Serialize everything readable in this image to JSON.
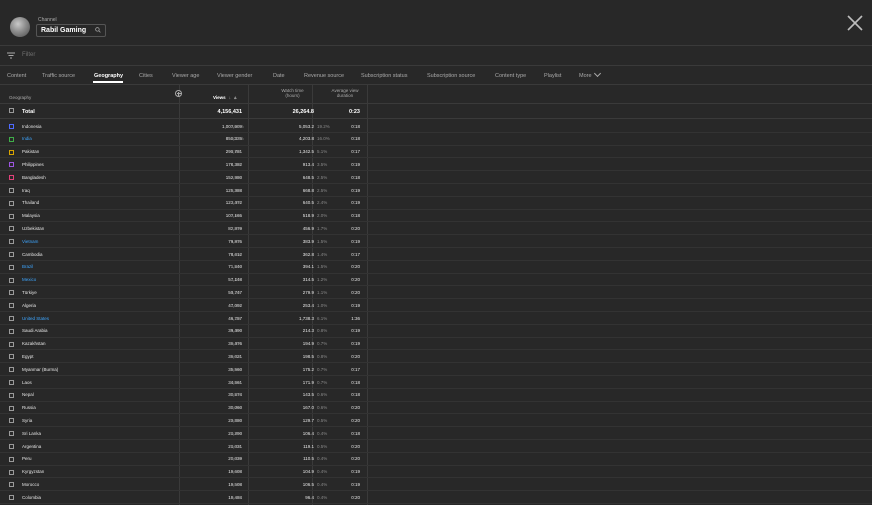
{
  "header": {
    "channel_label": "Channel",
    "channel_name": "Rabil Gaming"
  },
  "filter": {
    "placeholder": "Filter"
  },
  "tabs": [
    "Content",
    "Traffic source",
    "Geography",
    "Cities",
    "Viewer age",
    "Viewer gender",
    "Date",
    "Revenue source",
    "Subscription status",
    "Subscription source",
    "Content type",
    "Playlist",
    "More"
  ],
  "active_tab": "Geography",
  "columns": {
    "geography": "Geography",
    "views": "Views",
    "watch_time": "Watch time (hours)",
    "avg_view_duration": "Average view duration"
  },
  "total": {
    "label": "Total",
    "views": "4,156,431",
    "watch_time": "26,264.8",
    "avg": "0:23"
  },
  "rows": [
    {
      "name": "Indonesia",
      "views": "1,007,909",
      "vpct": "24.3%",
      "wt": "5,053.2",
      "wpct": "19.2%",
      "avg": "0:18",
      "color": "#4f6bff",
      "link": false
    },
    {
      "name": "India",
      "views": "850,335",
      "vpct": "20.5%",
      "wt": "4,203.8",
      "wpct": "16.0%",
      "avg": "0:18",
      "color": "#3fae49",
      "link": true
    },
    {
      "name": "Pakistan",
      "views": "290,781",
      "vpct": "7.0%",
      "wt": "1,342.5",
      "wpct": "5.1%",
      "avg": "0:17",
      "color": "#d9a400",
      "link": false
    },
    {
      "name": "Philippines",
      "views": "176,382",
      "vpct": "4.2%",
      "wt": "913.4",
      "wpct": "3.5%",
      "avg": "0:19",
      "color": "#9d55e0",
      "link": false
    },
    {
      "name": "Bangladesh",
      "views": "152,980",
      "vpct": "3.2%",
      "wt": "648.5",
      "wpct": "2.5%",
      "avg": "0:18",
      "color": "#e0417a",
      "link": false
    },
    {
      "name": "Iraq",
      "views": "125,388",
      "vpct": "3.0%",
      "wt": "668.8",
      "wpct": "2.5%",
      "avg": "0:19",
      "color": "",
      "link": false
    },
    {
      "name": "Thailand",
      "views": "123,472",
      "vpct": "3.0%",
      "wt": "640.5",
      "wpct": "2.4%",
      "avg": "0:19",
      "color": "",
      "link": false
    },
    {
      "name": "Malaysia",
      "views": "107,165",
      "vpct": "2.6%",
      "wt": "518.9",
      "wpct": "2.0%",
      "avg": "0:18",
      "color": "",
      "link": false
    },
    {
      "name": "Uzbekistan",
      "views": "82,879",
      "vpct": "2.0%",
      "wt": "456.9",
      "wpct": "1.7%",
      "avg": "0:20",
      "color": "",
      "link": false
    },
    {
      "name": "Vietnam",
      "views": "79,875",
      "vpct": "1.9%",
      "wt": "383.9",
      "wpct": "1.5%",
      "avg": "0:19",
      "color": "",
      "link": true
    },
    {
      "name": "Cambodia",
      "views": "78,612",
      "vpct": "1.8%",
      "wt": "362.8",
      "wpct": "1.4%",
      "avg": "0:17",
      "color": "",
      "link": false
    },
    {
      "name": "Brazil",
      "views": "71,540",
      "vpct": "1.7%",
      "wt": "394.1",
      "wpct": "1.5%",
      "avg": "0:20",
      "color": "",
      "link": true
    },
    {
      "name": "Mexico",
      "views": "57,148",
      "vpct": "1.4%",
      "wt": "314.5",
      "wpct": "1.2%",
      "avg": "0:20",
      "color": "",
      "link": true
    },
    {
      "name": "Türkiye",
      "views": "50,747",
      "vpct": "1.2%",
      "wt": "279.9",
      "wpct": "1.1%",
      "avg": "0:20",
      "color": "",
      "link": false
    },
    {
      "name": "Algeria",
      "views": "47,092",
      "vpct": "1.1%",
      "wt": "253.4",
      "wpct": "1.0%",
      "avg": "0:19",
      "color": "",
      "link": false
    },
    {
      "name": "United States",
      "views": "46,757",
      "vpct": "1.1%",
      "wt": "1,738.3",
      "wpct": "6.1%",
      "avg": "1:36",
      "color": "",
      "link": true
    },
    {
      "name": "Saudi Arabia",
      "views": "39,490",
      "vpct": "1.0%",
      "wt": "214.3",
      "wpct": "0.8%",
      "avg": "0:19",
      "color": "",
      "link": false
    },
    {
      "name": "Kazakhstan",
      "views": "36,476",
      "vpct": "0.9%",
      "wt": "194.9",
      "wpct": "0.7%",
      "avg": "0:19",
      "color": "",
      "link": false
    },
    {
      "name": "Egypt",
      "views": "36,021",
      "vpct": "0.9%",
      "wt": "198.5",
      "wpct": "0.8%",
      "avg": "0:20",
      "color": "",
      "link": false
    },
    {
      "name": "Myanmar (Burma)",
      "views": "35,560",
      "vpct": "0.9%",
      "wt": "175.2",
      "wpct": "0.7%",
      "avg": "0:17",
      "color": "",
      "link": false
    },
    {
      "name": "Laos",
      "views": "34,561",
      "vpct": "0.8%",
      "wt": "171.9",
      "wpct": "0.7%",
      "avg": "0:18",
      "color": "",
      "link": false
    },
    {
      "name": "Nepal",
      "views": "30,574",
      "vpct": "0.7%",
      "wt": "143.5",
      "wpct": "0.6%",
      "avg": "0:18",
      "color": "",
      "link": false
    },
    {
      "name": "Russia",
      "views": "30,060",
      "vpct": "0.7%",
      "wt": "167.0",
      "wpct": "0.6%",
      "avg": "0:20",
      "color": "",
      "link": false
    },
    {
      "name": "Syria",
      "views": "23,880",
      "vpct": "0.6%",
      "wt": "129.7",
      "wpct": "0.5%",
      "avg": "0:20",
      "color": "",
      "link": false
    },
    {
      "name": "Sri Lanka",
      "views": "21,290",
      "vpct": "0.5%",
      "wt": "106.4",
      "wpct": "0.4%",
      "avg": "0:18",
      "color": "",
      "link": false
    },
    {
      "name": "Argentina",
      "views": "21,031",
      "vpct": "0.5%",
      "wt": "119.1",
      "wpct": "0.5%",
      "avg": "0:20",
      "color": "",
      "link": false
    },
    {
      "name": "Peru",
      "views": "20,039",
      "vpct": "0.5%",
      "wt": "110.5",
      "wpct": "0.4%",
      "avg": "0:20",
      "color": "",
      "link": false
    },
    {
      "name": "Kyrgyzstan",
      "views": "19,608",
      "vpct": "0.5%",
      "wt": "104.9",
      "wpct": "0.4%",
      "avg": "0:19",
      "color": "",
      "link": false
    },
    {
      "name": "Morocco",
      "views": "19,508",
      "vpct": "0.5%",
      "wt": "106.5",
      "wpct": "0.4%",
      "avg": "0:19",
      "color": "",
      "link": false
    },
    {
      "name": "Colombia",
      "views": "18,484",
      "vpct": "0.4%",
      "wt": "96.4",
      "wpct": "0.4%",
      "avg": "0:20",
      "color": "",
      "link": false
    }
  ]
}
